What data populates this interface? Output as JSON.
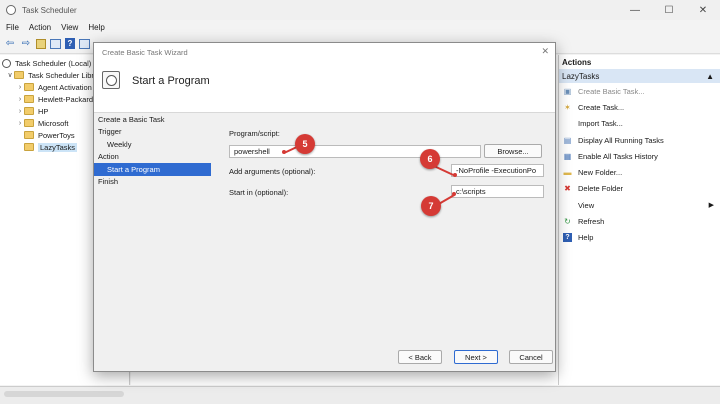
{
  "window": {
    "title": "Task Scheduler",
    "controls": [
      "—",
      "☐",
      "✕"
    ]
  },
  "menu": [
    "File",
    "Action",
    "View",
    "Help"
  ],
  "tree": {
    "items": [
      {
        "label": "Task Scheduler (Local)",
        "caret": "",
        "icon": "clock"
      },
      {
        "label": "Task Scheduler Library",
        "caret": "∨",
        "icon": "folder"
      },
      {
        "label": "Agent Activation",
        "caret": "›",
        "icon": "folder"
      },
      {
        "label": "Hewlett-Packard",
        "caret": "›",
        "icon": "folder"
      },
      {
        "label": "HP",
        "caret": "›",
        "icon": "folder"
      },
      {
        "label": "Microsoft",
        "caret": "›",
        "icon": "folder"
      },
      {
        "label": "PowerToys",
        "caret": "",
        "icon": "folder"
      },
      {
        "label": "LazyTasks",
        "caret": "",
        "icon": "folder",
        "selected": true
      }
    ]
  },
  "actions": {
    "header": "Actions",
    "section": "LazyTasks",
    "items": [
      {
        "label": "Create Basic Task...",
        "icon": "create-basic-task-icon",
        "glyph": "▣",
        "dim": true
      },
      {
        "label": "Create Task...",
        "icon": "create-task-icon",
        "glyph": "✶"
      },
      {
        "label": "Import Task...",
        "icon": "import-icon",
        "glyph": ""
      },
      {
        "label": "Display All Running Tasks",
        "icon": "running-tasks-icon",
        "glyph": "▤"
      },
      {
        "label": "Enable All Tasks History",
        "icon": "history-icon",
        "glyph": "▦"
      },
      {
        "label": "New Folder...",
        "icon": "new-folder-icon",
        "glyph": "▬"
      },
      {
        "label": "Delete Folder",
        "icon": "delete-icon",
        "glyph": "✖"
      },
      {
        "label": "View",
        "icon": "",
        "glyph": "",
        "submenu": true
      },
      {
        "label": "Refresh",
        "icon": "refresh-icon",
        "glyph": "↻"
      },
      {
        "label": "Help",
        "icon": "help-icon",
        "glyph": "?"
      }
    ]
  },
  "wizard": {
    "title": "Create Basic Task Wizard",
    "heading": "Start a Program",
    "steps": [
      {
        "label": "Create a Basic Task",
        "indent": false
      },
      {
        "label": "Trigger",
        "indent": false
      },
      {
        "label": "Weekly",
        "indent": true
      },
      {
        "label": "Action",
        "indent": false
      },
      {
        "label": "Start a Program",
        "indent": true,
        "current": true
      },
      {
        "label": "Finish",
        "indent": false
      }
    ],
    "program_label": "Program/script:",
    "program_value": "powershell",
    "browse_label": "Browse...",
    "args_label": "Add arguments (optional):",
    "args_value": "-NoProfile -ExecutionPo",
    "startin_label": "Start in (optional):",
    "startin_value": "c:\\scripts",
    "back_label": "< Back",
    "next_label": "Next >",
    "cancel_label": "Cancel"
  },
  "callouts": [
    "5",
    "6",
    "7"
  ],
  "colors": {
    "callout": "#d53a35",
    "selection": "#2f6bd1",
    "actions_section": "#d9e6f5"
  }
}
